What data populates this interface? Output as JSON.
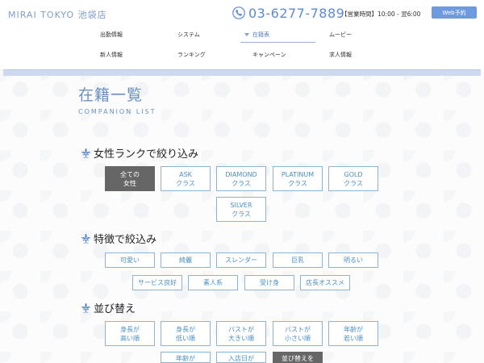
{
  "header": {
    "brand": "MIRAI TOKYO 池袋店",
    "phone": "03-6277-7889",
    "hours": "【営業時間】10:00 - 翌6:00",
    "web_button": "Web予約"
  },
  "nav": {
    "row1": [
      "出勤情報",
      "システム",
      "在籍表",
      "ムービー"
    ],
    "row2": [
      "新人情報",
      "ランキング",
      "キャンペーン",
      "求人情報"
    ],
    "active": "在籍表"
  },
  "page": {
    "title": "在籍一覧",
    "subtitle": "COMPANION LIST"
  },
  "rank_filter": {
    "heading": "女性ランクで絞り込み",
    "options": [
      [
        "全ての",
        "女性"
      ],
      [
        "ASK",
        "クラス"
      ],
      [
        "DIAMOND",
        "クラス"
      ],
      [
        "PLATINUM",
        "クラス"
      ],
      [
        "GOLD",
        "クラス"
      ],
      [
        "SILVER",
        "クラス"
      ]
    ],
    "selected": "全ての女性"
  },
  "feature_filter": {
    "heading": "特徴で絞込み",
    "options": [
      "可愛い",
      "綺麗",
      "スレンダー",
      "巨乳",
      "明るい",
      "サービス良好",
      "素人系",
      "受け身",
      "店長オススメ"
    ]
  },
  "sort": {
    "heading": "並び替え",
    "options": [
      [
        "身長が",
        "高い順"
      ],
      [
        "身長が",
        "低い順"
      ],
      [
        "バストが",
        "大きい順"
      ],
      [
        "バストが",
        "小さい順"
      ],
      [
        "年齢が",
        "若い順"
      ],
      [
        "年齢が",
        ""
      ],
      [
        "入店日が",
        ""
      ],
      [
        "並び替えを",
        ""
      ]
    ],
    "selected": "並び替えを"
  },
  "colors": {
    "accent": "#5b8bd0",
    "heading_blue": "#6b90c4",
    "box_border": "#8ab5d6",
    "box_text": "#4b8fc4",
    "selected_bg": "#666666",
    "web_button_bg": "#6e9be0"
  },
  "icons": [
    "phone-icon",
    "fleur-de-lis-icon"
  ]
}
